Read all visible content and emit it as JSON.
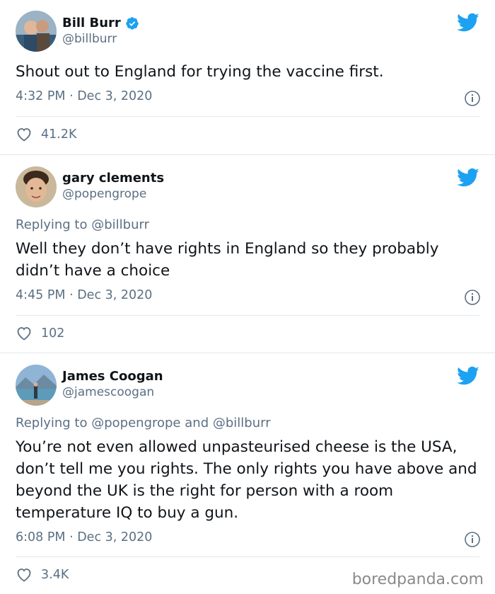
{
  "tweets": [
    {
      "name": "Bill Burr",
      "handle": "@billburr",
      "verified": true,
      "replying_prefix": "",
      "replying_to": [],
      "text": "Shout out to England for trying the vaccine first.",
      "timestamp": "4:32 PM · Dec 3, 2020",
      "likes": "41.2K"
    },
    {
      "name": "gary clements",
      "handle": "@popengrope",
      "verified": false,
      "replying_prefix": "Replying to",
      "replying_to": [
        "@billburr"
      ],
      "text": "Well they don’t have rights in England so they probably didn’t have a choice",
      "timestamp": "4:45 PM · Dec 3, 2020",
      "likes": "102"
    },
    {
      "name": "James Coogan",
      "handle": "@jamescoogan",
      "verified": false,
      "replying_prefix": "Replying to",
      "replying_join": "and",
      "replying_to": [
        "@popengrope",
        "@billburr"
      ],
      "text": "You’re not even allowed unpasteurised cheese is the USA, don’t tell me you rights. The only rights you have above and beyond the UK is the right for person with a room temperature IQ to buy a gun.",
      "timestamp": "6:08 PM · Dec 3, 2020",
      "likes": "3.4K"
    }
  ],
  "watermark": "boredpanda.com",
  "colors": {
    "twitter_blue": "#1da1f2",
    "secondary_text": "#5b7083",
    "divider": "#e1e8ed"
  },
  "icons": [
    "twitter-bird-icon",
    "verified-badge-icon",
    "info-icon",
    "heart-icon"
  ]
}
